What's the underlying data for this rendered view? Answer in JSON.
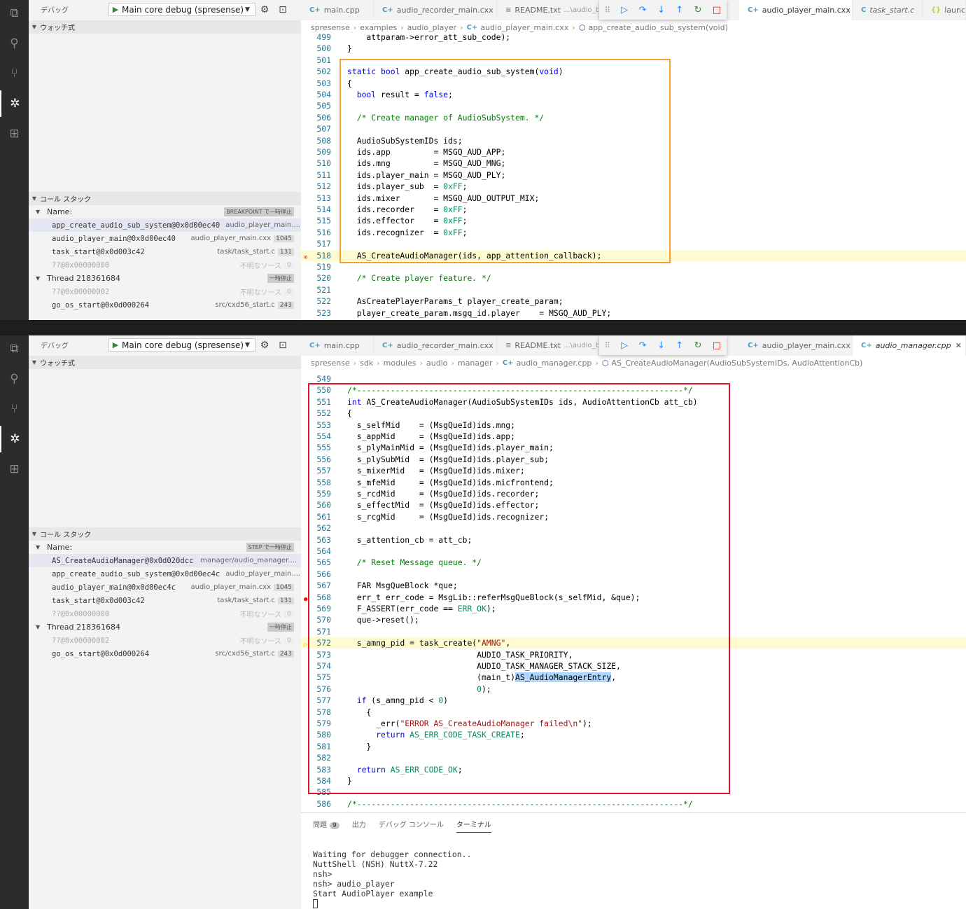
{
  "activity_icons": [
    "explorer-icon",
    "search-icon",
    "source-control-icon",
    "debug-icon",
    "extensions-icon"
  ],
  "colors": {
    "orange_box": "#f5a030",
    "red_box": "#e81123",
    "accent": "#007acc"
  },
  "pane1": {
    "debug_bar": {
      "label": "デバッグ",
      "config": "Main core debug (spresense)"
    },
    "watch": {
      "title": "ウォッチ式"
    },
    "callstack": {
      "title": "コール スタック",
      "name_header": "Name:",
      "status": "BREAKPOINT で一時停止",
      "frames": [
        {
          "fn": "app_create_audio_sub_system@0x0d00ec40",
          "src": "audio_player_main....",
          "line": ""
        },
        {
          "fn": "audio_player_main@0x0d00ec40",
          "src": "audio_player_main.cxx",
          "line": "1045"
        },
        {
          "fn": "task_start@0x0d003c42",
          "src": "task/task_start.c",
          "line": "131"
        },
        {
          "fn": "??@0x00000000",
          "src": "不明なソース",
          "line": "0"
        }
      ],
      "thread": {
        "name": "Thread 218361684",
        "status": "一時停止"
      },
      "thread_frames": [
        {
          "fn": "??@0x00000002",
          "src": "不明なソース",
          "line": "0"
        },
        {
          "fn": "go_os_start@0x0d000264",
          "src": "src/cxd56_start.c",
          "line": "243"
        }
      ]
    },
    "tabs": [
      {
        "icon": "C+",
        "name": "main.cpp",
        "desc": ""
      },
      {
        "icon": "C+",
        "name": "audio_recorder_main.cxx",
        "desc": ""
      },
      {
        "icon": "≡",
        "name": "README.txt",
        "desc": "...\\audio_be"
      },
      {
        "icon": "C+",
        "name": "audio_player_main.cxx",
        "desc": ""
      },
      {
        "icon": "C",
        "name": "task_start.c",
        "desc": ""
      },
      {
        "icon": "{}",
        "name": "launc",
        "desc": ""
      }
    ],
    "breadcrumb": [
      "spresense",
      "examples",
      "audio_player",
      "audio_player_main.cxx",
      "app_create_audio_sub_system(void)"
    ],
    "code": [
      [
        "499",
        "    attparam->error_att_sub_code);"
      ],
      [
        "500",
        "}"
      ],
      [
        "501",
        ""
      ],
      [
        "502",
        "static bool app_create_audio_sub_system(void)"
      ],
      [
        "503",
        "{"
      ],
      [
        "504",
        "  bool result = false;"
      ],
      [
        "505",
        ""
      ],
      [
        "506",
        "  /* Create manager of AudioSubSystem. */"
      ],
      [
        "507",
        ""
      ],
      [
        "508",
        "  AudioSubSystemIDs ids;"
      ],
      [
        "509",
        "  ids.app         = MSGQ_AUD_APP;"
      ],
      [
        "510",
        "  ids.mng         = MSGQ_AUD_MNG;"
      ],
      [
        "511",
        "  ids.player_main = MSGQ_AUD_PLY;"
      ],
      [
        "512",
        "  ids.player_sub  = 0xFF;"
      ],
      [
        "513",
        "  ids.mixer       = MSGQ_AUD_OUTPUT_MIX;"
      ],
      [
        "514",
        "  ids.recorder    = 0xFF;"
      ],
      [
        "515",
        "  ids.effector    = 0xFF;"
      ],
      [
        "516",
        "  ids.recognizer  = 0xFF;"
      ],
      [
        "517",
        ""
      ],
      [
        "518",
        "  AS_CreateAudioManager(ids, app_attention_callback);"
      ],
      [
        "519",
        ""
      ],
      [
        "520",
        "  /* Create player feature. */"
      ],
      [
        "521",
        ""
      ],
      [
        "522",
        "  AsCreatePlayerParams_t player_create_param;"
      ],
      [
        "523",
        "  player_create_param.msgq_id.player    = MSGQ_AUD_PLY;"
      ]
    ]
  },
  "pane2": {
    "debug_bar": {
      "label": "デバッグ",
      "config": "Main core debug (spresense)"
    },
    "watch": {
      "title": "ウォッチ式"
    },
    "callstack": {
      "title": "コール スタック",
      "name_header": "Name:",
      "status": "STEP で一時停止",
      "frames": [
        {
          "fn": "AS_CreateAudioManager@0x0d020dcc",
          "src": "manager/audio_manager....",
          "line": ""
        },
        {
          "fn": "app_create_audio_sub_system@0x0d00ec4c",
          "src": "audio_player_main....",
          "line": ""
        },
        {
          "fn": "audio_player_main@0x0d00ec4c",
          "src": "audio_player_main.cxx",
          "line": "1045"
        },
        {
          "fn": "task_start@0x0d003c42",
          "src": "task/task_start.c",
          "line": "131"
        },
        {
          "fn": "??@0x00000000",
          "src": "不明なソース",
          "line": "0"
        }
      ],
      "thread": {
        "name": "Thread 218361684",
        "status": "一時停止"
      },
      "thread_frames": [
        {
          "fn": "??@0x00000002",
          "src": "不明なソース",
          "line": "0"
        },
        {
          "fn": "go_os_start@0x0d000264",
          "src": "src/cxd56_start.c",
          "line": "243"
        }
      ]
    },
    "tabs": [
      {
        "icon": "C+",
        "name": "main.cpp",
        "desc": ""
      },
      {
        "icon": "C+",
        "name": "audio_recorder_main.cxx",
        "desc": ""
      },
      {
        "icon": "≡",
        "name": "README.txt",
        "desc": "...\\audio_be"
      },
      {
        "icon": "C+",
        "name": "audio_player_main.cxx",
        "desc": ""
      },
      {
        "icon": "C+",
        "name": "audio_manager.cpp",
        "desc": ""
      }
    ],
    "breadcrumb": [
      "spresense",
      "sdk",
      "modules",
      "audio",
      "manager",
      "audio_manager.cpp",
      "AS_CreateAudioManager(AudioSubSystemIDs, AudioAttentionCb)"
    ],
    "code": [
      [
        "549",
        ""
      ],
      [
        "550",
        "/*--------------------------------------------------------------------*/"
      ],
      [
        "551",
        "int AS_CreateAudioManager(AudioSubSystemIDs ids, AudioAttentionCb att_cb)"
      ],
      [
        "552",
        "{"
      ],
      [
        "553",
        "  s_selfMid    = (MsgQueId)ids.mng;"
      ],
      [
        "554",
        "  s_appMid     = (MsgQueId)ids.app;"
      ],
      [
        "555",
        "  s_plyMainMid = (MsgQueId)ids.player_main;"
      ],
      [
        "556",
        "  s_plySubMid  = (MsgQueId)ids.player_sub;"
      ],
      [
        "557",
        "  s_mixerMid   = (MsgQueId)ids.mixer;"
      ],
      [
        "558",
        "  s_mfeMid     = (MsgQueId)ids.micfrontend;"
      ],
      [
        "559",
        "  s_rcdMid     = (MsgQueId)ids.recorder;"
      ],
      [
        "560",
        "  s_effectMid  = (MsgQueId)ids.effector;"
      ],
      [
        "561",
        "  s_rcgMid     = (MsgQueId)ids.recognizer;"
      ],
      [
        "562",
        ""
      ],
      [
        "563",
        "  s_attention_cb = att_cb;"
      ],
      [
        "564",
        ""
      ],
      [
        "565",
        "  /* Reset Message queue. */"
      ],
      [
        "566",
        ""
      ],
      [
        "567",
        "  FAR MsgQueBlock *que;"
      ],
      [
        "568",
        "  err_t err_code = MsgLib::referMsgQueBlock(s_selfMid, &que);"
      ],
      [
        "569",
        "  F_ASSERT(err_code == ERR_OK);"
      ],
      [
        "570",
        "  que->reset();"
      ],
      [
        "571",
        ""
      ],
      [
        "572",
        "  s_amng_pid = task_create(\"AMNG\","
      ],
      [
        "573",
        "                           AUDIO_TASK_PRIORITY,"
      ],
      [
        "574",
        "                           AUDIO_TASK_MANAGER_STACK_SIZE,"
      ],
      [
        "575",
        "                           (main_t)AS_AudioManagerEntry,"
      ],
      [
        "576",
        "                           0);"
      ],
      [
        "577",
        "  if (s_amng_pid < 0)"
      ],
      [
        "578",
        "    {"
      ],
      [
        "579",
        "      _err(\"ERROR AS_CreateAudioManager failed\\n\");"
      ],
      [
        "580",
        "      return AS_ERR_CODE_TASK_CREATE;"
      ],
      [
        "581",
        "    }"
      ],
      [
        "582",
        ""
      ],
      [
        "583",
        "  return AS_ERR_CODE_OK;"
      ],
      [
        "584",
        "}"
      ],
      [
        "585",
        ""
      ],
      [
        "586",
        "/*--------------------------------------------------------------------*/"
      ]
    ],
    "panel": {
      "tabs": [
        "問題",
        "出力",
        "デバッグ コンソール",
        "ターミナル"
      ],
      "problems_count": "9",
      "terminal": [
        "Waiting for debugger connection..",
        "NuttShell (NSH) NuttX-7.22",
        "nsh>",
        "nsh> audio_player",
        "Start AudioPlayer example"
      ]
    }
  }
}
